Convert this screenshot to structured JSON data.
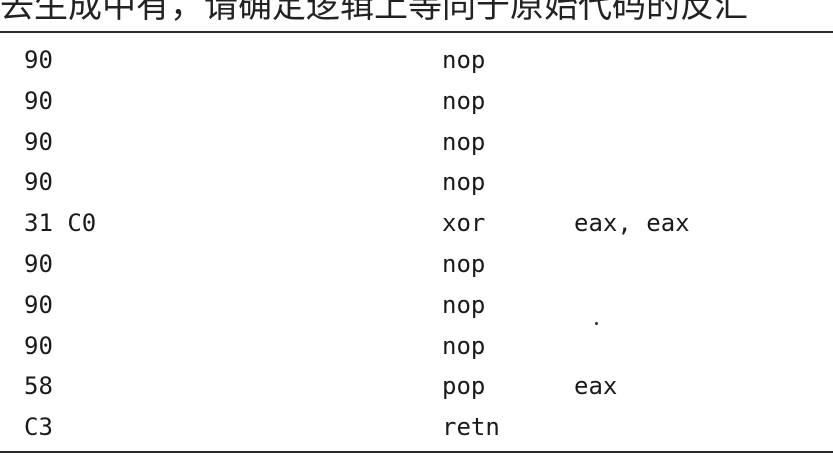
{
  "header_text": "去生成中有，请确定逻辑上等同于原始代码的反汇",
  "listing": [
    {
      "bytes": "90",
      "mnemonic": "nop",
      "operands": ""
    },
    {
      "bytes": "90",
      "mnemonic": "nop",
      "operands": ""
    },
    {
      "bytes": "90",
      "mnemonic": "nop",
      "operands": ""
    },
    {
      "bytes": "90",
      "mnemonic": "nop",
      "operands": ""
    },
    {
      "bytes": "31 C0",
      "mnemonic": "xor",
      "operands": "eax, eax"
    },
    {
      "bytes": "90",
      "mnemonic": "nop",
      "operands": ""
    },
    {
      "bytes": "90",
      "mnemonic": "nop",
      "operands": ""
    },
    {
      "bytes": "90",
      "mnemonic": "nop",
      "operands": ""
    },
    {
      "bytes": "58",
      "mnemonic": "pop",
      "operands": "eax"
    },
    {
      "bytes": "C3",
      "mnemonic": "retn",
      "operands": ""
    }
  ]
}
